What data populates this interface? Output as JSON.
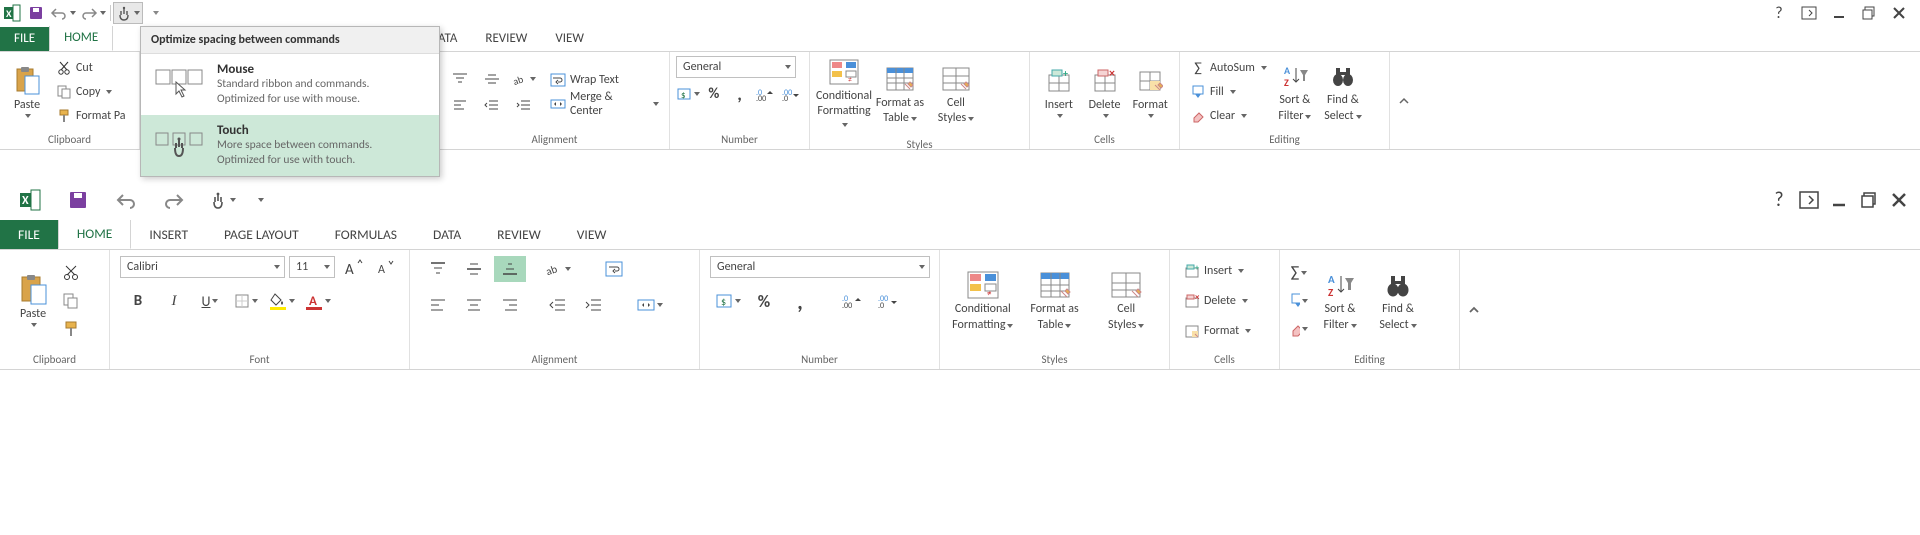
{
  "qat": {
    "title_hidden": ""
  },
  "tabs": {
    "file": "FILE",
    "home": "HOME",
    "insert": "INSERT",
    "page_layout": "PAGE LAYOUT",
    "formulas": "FORMULAS",
    "data": "DATA",
    "review": "REVIEW",
    "view": "VIEW"
  },
  "popup": {
    "header": "Optimize spacing between commands",
    "mouse": {
      "title": "Mouse",
      "desc1": "Standard ribbon and commands.",
      "desc2": "Optimized for use with mouse."
    },
    "touch": {
      "title": "Touch",
      "desc1": "More space between commands.",
      "desc2": "Optimized for use with touch."
    }
  },
  "clipboard": {
    "paste": "Paste",
    "cut": "Cut",
    "copy": "Copy",
    "format_painter": "Format Painter",
    "format_painter_short": "Format Pa",
    "group": "Clipboard"
  },
  "font": {
    "name": "Calibri",
    "size": "11",
    "group": "Font"
  },
  "alignment": {
    "wrap": "Wrap Text",
    "merge": "Merge & Center",
    "group": "Alignment"
  },
  "number": {
    "format": "General",
    "group": "Number"
  },
  "styles": {
    "cond": "Conditional",
    "cond2": "Formatting",
    "fat": "Format as",
    "fat2": "Table",
    "cell": "Cell",
    "cell2": "Styles",
    "group": "Styles"
  },
  "cells": {
    "insert": "Insert",
    "delete": "Delete",
    "format": "Format",
    "group": "Cells"
  },
  "editing": {
    "autosum": "AutoSum",
    "fill": "Fill",
    "clear": "Clear",
    "sort": "Sort &",
    "sort2": "Filter",
    "find": "Find &",
    "find2": "Select",
    "group": "Editing"
  }
}
